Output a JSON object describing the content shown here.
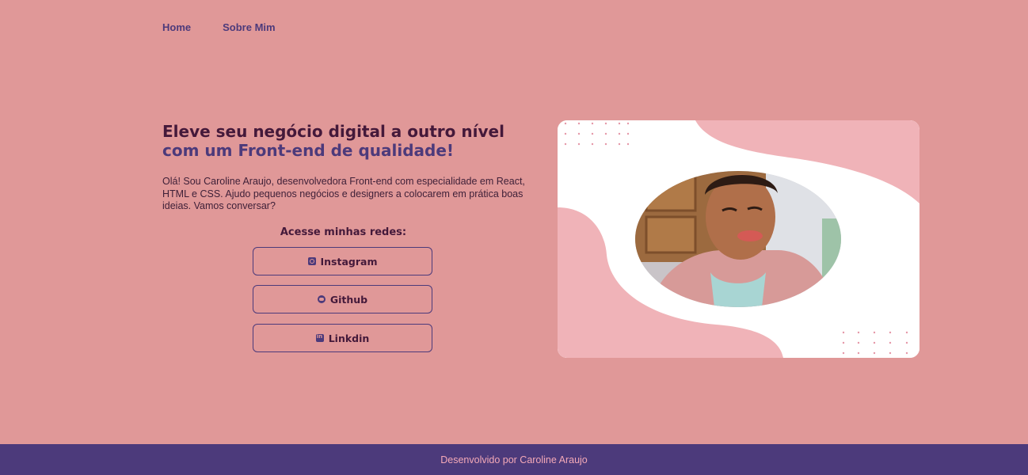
{
  "nav": {
    "home": "Home",
    "about": "Sobre Mim"
  },
  "hero": {
    "title_line1": "Eleve seu negócio digital a outro nível",
    "title_line2": "com um Front-end de qualidade!",
    "intro": "Olá! Sou Caroline Araujo, desenvolvedora Front-end com especialidade em React, HTML e CSS. Ajudo pequenos negócios e designers a colocarem em prática boas ideias. Vamos conversar?"
  },
  "socials": {
    "title": "Acesse minhas redes:",
    "instagram": "Instagram",
    "github": "Github",
    "linkedin": "Linkdin"
  },
  "footer": {
    "text": "Desenvolvido por Caroline Araujo"
  },
  "colors": {
    "page_bg": "#e09898",
    "accent_purple": "#4c3a7b",
    "dark_plum": "#44193a",
    "card_pink": "#f0b3b8",
    "footer_text": "#f4a9b7"
  },
  "icons": [
    "instagram-icon",
    "github-icon",
    "linkedin-icon"
  ]
}
